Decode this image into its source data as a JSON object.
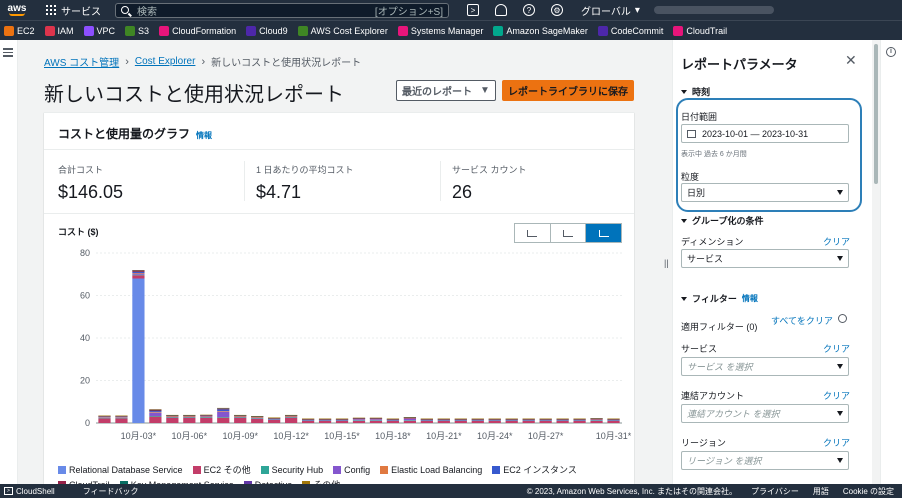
{
  "topnav": {
    "services_label": "サービス",
    "search_placeholder": "検索",
    "search_hint": "[オプション+S]",
    "region_label": "グローバル"
  },
  "favorites": [
    {
      "label": "EC2",
      "color": "#ec7211"
    },
    {
      "label": "IAM",
      "color": "#dd344c"
    },
    {
      "label": "VPC",
      "color": "#8c4fff"
    },
    {
      "label": "S3",
      "color": "#3f8624"
    },
    {
      "label": "CloudFormation",
      "color": "#e7157b"
    },
    {
      "label": "Cloud9",
      "color": "#4d27aa"
    },
    {
      "label": "AWS Cost Explorer",
      "color": "#3f8624"
    },
    {
      "label": "Systems Manager",
      "color": "#e7157b"
    },
    {
      "label": "Amazon SageMaker",
      "color": "#01a88d"
    },
    {
      "label": "CodeCommit",
      "color": "#4d27aa"
    },
    {
      "label": "CloudTrail",
      "color": "#e7157b"
    }
  ],
  "breadcrumb": {
    "items": [
      "AWS コスト管理",
      "Cost Explorer"
    ],
    "current": "新しいコストと使用状況レポート"
  },
  "page": {
    "title": "新しいコストと使用状況レポート",
    "recent_reports_label": "最近のレポート",
    "save_label": "レポートライブラリに保存"
  },
  "card": {
    "title": "コストと使用量のグラフ",
    "info_label": "情報",
    "stats": [
      {
        "label": "合計コスト",
        "value": "$146.05"
      },
      {
        "label": "1 日あたりの平均コスト",
        "value": "$4.71"
      },
      {
        "label": "サービス カウント",
        "value": "26"
      }
    ],
    "chart_ylabel": "コスト ($)"
  },
  "chart_data": {
    "type": "bar",
    "stacked": true,
    "ylabel": "コスト ($)",
    "ylim": [
      0,
      80
    ],
    "yticks": [
      0,
      20,
      40,
      60,
      80
    ],
    "grid": true,
    "legend_position": "bottom",
    "x_tick_labels": [
      "10月-03*",
      "10月-06*",
      "10月-09*",
      "10月-12*",
      "10月-15*",
      "10月-18*",
      "10月-21*",
      "10月-24*",
      "10月-27*",
      "10月-31*"
    ],
    "x_tick_indices": [
      2,
      5,
      8,
      11,
      14,
      17,
      20,
      23,
      26,
      30
    ],
    "days": 31,
    "series": [
      {
        "name": "Relational Database Service",
        "color": "#688ae8",
        "values": [
          0,
          0,
          68,
          0,
          0,
          0,
          0,
          0,
          0,
          0,
          0,
          0,
          0,
          0,
          0,
          0,
          0,
          0,
          0,
          0,
          0,
          0,
          0,
          0,
          0,
          0,
          0,
          0,
          0,
          0,
          0
        ]
      },
      {
        "name": "EC2 その他",
        "color": "#c33d69",
        "values": [
          2.2,
          2.2,
          1.5,
          3,
          2.5,
          2.5,
          2.5,
          2.5,
          2.5,
          2,
          1.5,
          2.5,
          1,
          1,
          1,
          1,
          1,
          1,
          1,
          1,
          1,
          1,
          1,
          1,
          1,
          1,
          1,
          1,
          1,
          1,
          1
        ]
      },
      {
        "name": "Security Hub",
        "color": "#2ea597",
        "values": [
          0.3,
          0.3,
          0.3,
          0.3,
          0.3,
          0.3,
          0.3,
          0.3,
          0.3,
          0.3,
          0.3,
          0.3,
          0.3,
          0.3,
          0.3,
          0.3,
          0.3,
          0.3,
          0.3,
          0.3,
          0.3,
          0.3,
          0.3,
          0.3,
          0.3,
          0.3,
          0.3,
          0.3,
          0.3,
          0.3,
          0.3
        ]
      },
      {
        "name": "Config",
        "color": "#8456ce",
        "values": [
          0.2,
          0.2,
          0.5,
          1.5,
          0.2,
          0.2,
          0.3,
          2.5,
          0.2,
          0.2,
          0.1,
          0.2,
          0.1,
          0.1,
          0.1,
          0.5,
          0.5,
          0.1,
          0.8,
          0.1,
          0.1,
          0.1,
          0.1,
          0.1,
          0.1,
          0.1,
          0.1,
          0.1,
          0.1,
          0.3,
          0.1
        ]
      },
      {
        "name": "Elastic Load Balancing",
        "color": "#e07941",
        "values": [
          0.3,
          0.3,
          0.3,
          0.3,
          0.3,
          0.3,
          0.3,
          0.3,
          0.3,
          0.3,
          0.3,
          0.3,
          0.3,
          0.3,
          0.3,
          0.3,
          0.3,
          0.3,
          0.3,
          0.3,
          0.3,
          0.3,
          0.3,
          0.3,
          0.3,
          0.3,
          0.3,
          0.3,
          0.3,
          0.3,
          0.3
        ]
      },
      {
        "name": "EC2 インスタンス",
        "color": "#3759ce",
        "values": [
          0,
          0,
          0.5,
          0.5,
          0,
          0,
          0,
          0.8,
          0,
          0,
          0,
          0,
          0,
          0,
          0,
          0,
          0,
          0,
          0,
          0,
          0,
          0,
          0,
          0,
          0,
          0,
          0,
          0,
          0,
          0,
          0
        ]
      },
      {
        "name": "CloudTrail",
        "color": "#962249",
        "values": [
          0.2,
          0.2,
          0.5,
          0.5,
          0.2,
          0.2,
          0.2,
          0.3,
          0.2,
          0.2,
          0.1,
          0.2,
          0.1,
          0.1,
          0.1,
          0.1,
          0.1,
          0.1,
          0.1,
          0.1,
          0.1,
          0.1,
          0.1,
          0.1,
          0.1,
          0.1,
          0.1,
          0.1,
          0.1,
          0.1,
          0.1
        ]
      },
      {
        "name": "Key Management Service",
        "color": "#096f64",
        "values": [
          0.1,
          0.1,
          0.1,
          0.1,
          0.1,
          0.1,
          0.1,
          0.1,
          0.1,
          0.1,
          0.1,
          0.1,
          0.1,
          0.1,
          0.1,
          0.1,
          0.1,
          0.1,
          0.1,
          0.1,
          0.1,
          0.1,
          0.1,
          0.1,
          0.1,
          0.1,
          0.1,
          0.1,
          0.1,
          0.1,
          0.1
        ]
      },
      {
        "name": "Detective",
        "color": "#6237a7",
        "values": [
          0.1,
          0.1,
          0.1,
          0.1,
          0.1,
          0.1,
          0.1,
          0.1,
          0.1,
          0.1,
          0.1,
          0.1,
          0.1,
          0.1,
          0.1,
          0.1,
          0.1,
          0.1,
          0.1,
          0.1,
          0.1,
          0.1,
          0.1,
          0.1,
          0.1,
          0.1,
          0.1,
          0.1,
          0.1,
          0.1,
          0.1
        ]
      },
      {
        "name": "その他",
        "color": "#a2780a",
        "values": [
          0.1,
          0.1,
          0.2,
          0.2,
          0.1,
          0.1,
          0.1,
          0.2,
          0.1,
          0.1,
          0.1,
          0.1,
          0.1,
          0.1,
          0.1,
          0.1,
          0.1,
          0.1,
          0.1,
          0.1,
          0.1,
          0.1,
          0.1,
          0.1,
          0.1,
          0.1,
          0.1,
          0.1,
          0.1,
          0.1,
          0.1
        ]
      }
    ]
  },
  "panel": {
    "title": "レポートパラメータ",
    "time_section": "時刻",
    "date_range_label": "日付範囲",
    "date_range_value": "2023-10-01 — 2023-10-31",
    "date_hint": "表示中 過去 6 か月間",
    "granularity_label": "粒度",
    "granularity_value": "日別",
    "group_section": "グループ化の条件",
    "dimension_label": "ディメンション",
    "dimension_clear": "クリア",
    "dimension_value": "サービス",
    "filter_section": "フィルター",
    "filter_info": "情報",
    "applied_filters": "適用フィルター (0)",
    "clear_all": "すべてをクリア",
    "service_label": "サービス",
    "service_clear": "クリア",
    "service_placeholder": "サービス を選択",
    "account_label": "連結アカウント",
    "account_clear": "クリア",
    "account_placeholder": "連結アカウント を選択",
    "region_label": "リージョン",
    "region_clear": "クリア",
    "region_placeholder": "リージョン を選択"
  },
  "footer": {
    "cloudshell": "CloudShell",
    "feedback": "フィードバック",
    "copyright": "© 2023, Amazon Web Services, Inc. またはその関連会社。",
    "privacy": "プライバシー",
    "terms": "用語",
    "cookie": "Cookie の設定"
  }
}
